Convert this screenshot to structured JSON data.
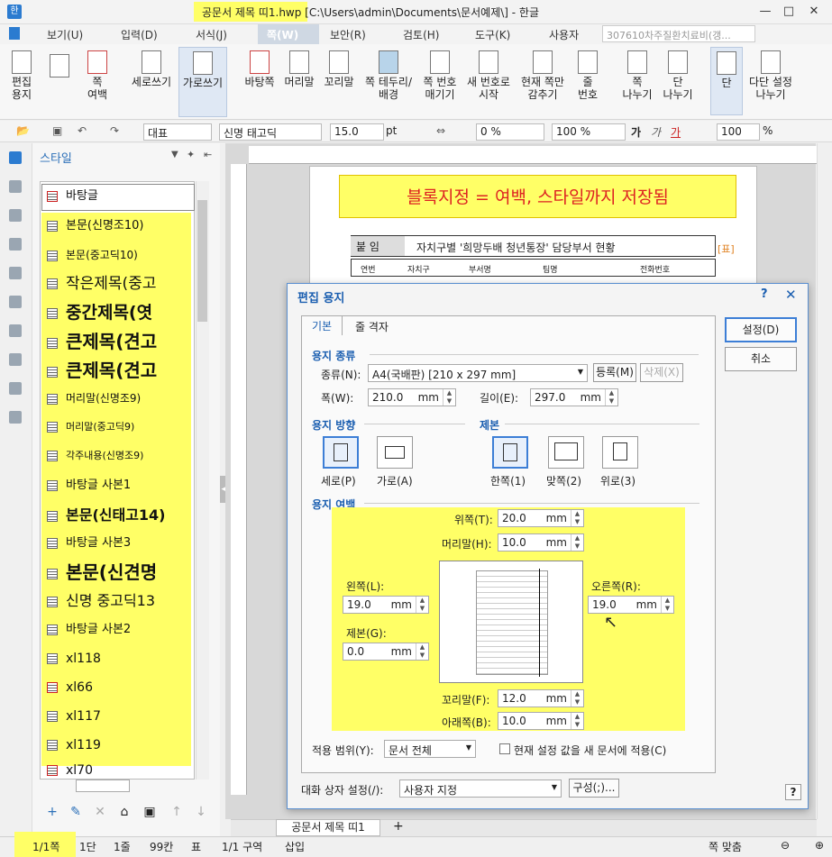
{
  "titlebar": {
    "app_icon": "한",
    "title": "공문서 제목 띠1.hwp [C:\\Users\\admin\\Documents\\문서예제\\] - 한글"
  },
  "menus": [
    "보기(U)",
    "입력(D)",
    "서식(J)",
    "쪽(W)",
    "보안(R)",
    "검토(H)",
    "도구(K)",
    "사용자"
  ],
  "search_text": "307610차주질환치료비(갱...",
  "ribbon": [
    "편집\n용지",
    "쪽\n여백",
    "세로쓰기",
    "가로쓰기",
    "바탕쪽",
    "머리말",
    "꼬리말",
    "쪽 테두리/\n배경",
    "쪽 번호\n매기기",
    "새 번호로\n시작",
    "현재 쪽만\n감추기",
    "줄\n번호",
    "쪽\n나누기",
    "단\n나누기",
    "단",
    "다단 설정\n나누기"
  ],
  "format": {
    "style": "대표",
    "font": "신명 태고딕",
    "size": "15.0",
    "size_unit": "pt",
    "spacing": "0 %",
    "ratio": "100 %",
    "zoom": "100",
    "zoom_unit": "%"
  },
  "style_panel": {
    "title": "스타일",
    "items": [
      "바탕글",
      "본문(신명조10)",
      "본문(중고딕10)",
      "작은제목(중고",
      "중간제목(엿",
      "큰제목(견고",
      "큰제목(견고",
      "머리말(신명조9)",
      "머리말(중고딕9)",
      "각주내용(신명조9)",
      "바탕글 사본1",
      "본문(신태고14)",
      "바탕글 사본3",
      "본문(신견명",
      "신명 중고딕13",
      "바탕글 사본2",
      "xl118",
      "xl66",
      "xl117",
      "xl119",
      "xl70"
    ]
  },
  "document": {
    "banner": "블록지정 = 여백, 스타일까지 저장됨",
    "table_tag": "붙 임",
    "table_title": "자치구별 '희망두배 청년통장' 담당부서 현황",
    "table_mark": "[표]",
    "columns": [
      "연번",
      "자치구",
      "부서명",
      "팀명",
      "전화번호"
    ],
    "tab_name": "공문서 제목 띠1"
  },
  "dialog": {
    "title": "편집 용지",
    "tabs": [
      "기본",
      "줄 격자"
    ],
    "paper_section": "용지 종류",
    "kind_label": "종류(N):",
    "kind_value": "A4(국배판) [210 x 297 mm]",
    "register_btn": "등록(M)",
    "delete_btn": "삭제(X)",
    "width_label": "폭(W):",
    "width_value": "210.0",
    "length_label": "길이(E):",
    "length_value": "297.0",
    "unit": "mm",
    "orient_section": "용지 방향",
    "portrait": "세로(P)",
    "landscape": "가로(A)",
    "binding_section": "제본",
    "bind_one": "한쪽(1)",
    "bind_face": "맞쪽(2)",
    "bind_top": "위로(3)",
    "margin_section": "용지 여백",
    "top_label": "위쪽(T):",
    "top_value": "20.0",
    "header_label": "머리말(H):",
    "header_value": "10.0",
    "left_label": "왼쪽(L):",
    "left_value": "19.0",
    "right_label": "오른쪽(R):",
    "right_value": "19.0",
    "gutter_label": "제본(G):",
    "gutter_value": "0.0",
    "footer_label": "꼬리말(F):",
    "footer_value": "12.0",
    "bottom_label": "아래쪽(B):",
    "bottom_value": "10.0",
    "apply_label": "적용 범위(Y):",
    "apply_value": "문서 전체",
    "apply_new_label": "현재 설정 값을 새 문서에 적용(C)",
    "dialog_setting_label": "대화 상자 설정(/):",
    "dialog_setting_value": "사용자 지정",
    "compose_btn": "구성(;)...",
    "ok_btn": "설정(D)",
    "cancel_btn": "취소",
    "help": "?"
  },
  "status": [
    "1/1쪽",
    "1단",
    "1줄",
    "99칸",
    "표",
    "1/1 구역",
    "삽입"
  ],
  "status_zoom": "쪽 맞춤",
  "colors": {
    "highlight": "#ffff66",
    "accent": "#1a5eb0",
    "banner_text": "#dd2222"
  }
}
